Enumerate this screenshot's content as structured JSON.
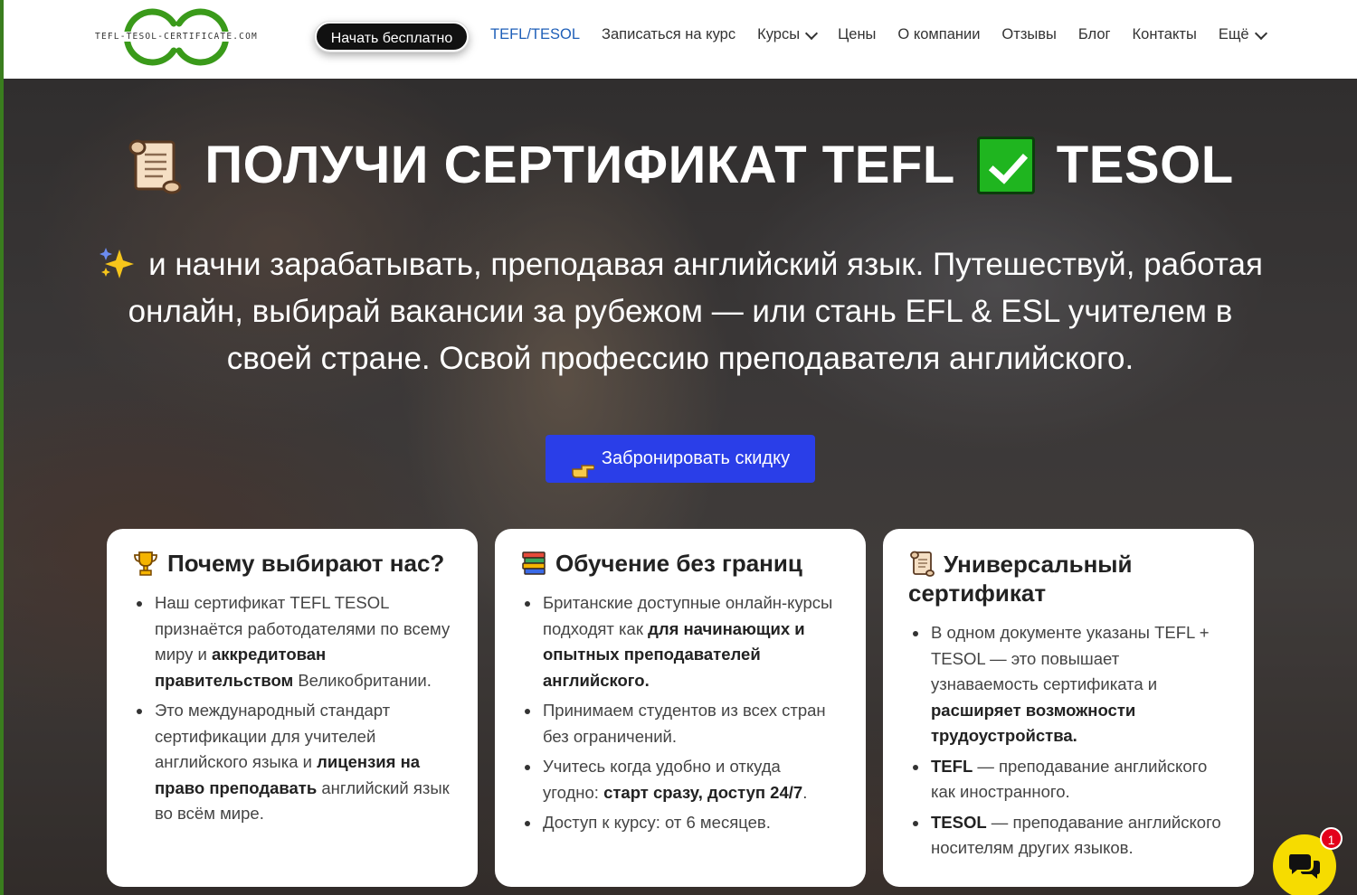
{
  "header": {
    "logo_text": "TEFL-TESOL-CERTIFICATE.COM",
    "cta_label": "Начать бесплатно",
    "nav": [
      {
        "label": "TEFL/TESOL",
        "active": true
      },
      {
        "label": "Записаться на курс"
      },
      {
        "label": "Курсы",
        "has_dropdown": true
      },
      {
        "label": "Цены"
      },
      {
        "label": "О компании"
      },
      {
        "label": "Отзывы"
      },
      {
        "label": "Блог"
      },
      {
        "label": "Контакты"
      },
      {
        "label": "Ещё",
        "has_dropdown": true
      }
    ]
  },
  "hero": {
    "title_part1": "ПОЛУЧИ СЕРТИФИКАТ TEFL",
    "title_part2": "TESOL",
    "title_icon_left": "scroll-icon",
    "title_icon_mid": "check-mark-icon",
    "subtitle_icon": "sparkles-icon",
    "subtitle": "и начни зарабатывать, преподавая английский язык. Путешествуй, работая онлайн, выбирай вакансии за рубежом — или стань EFL & ESL учителем в своей стране. Освой профессию преподавателя английского.",
    "button_label": "Забронировать скидку",
    "button_icon": "pointing-hand-icon"
  },
  "cards": [
    {
      "icon": "trophy-icon",
      "title": "Почему выбирают нас?",
      "items": [
        [
          "Наш сертификат TEFL TESOL признаётся работодателями по всему миру и ",
          "аккредитован правительством",
          " Великобритании."
        ],
        [
          "Это международный стандарт сертификации для учителей английского языка и ",
          "лицензия на право преподавать",
          " английский язык во всём мире."
        ]
      ]
    },
    {
      "icon": "books-icon",
      "title": "Обучение без границ",
      "items": [
        [
          "Британские доступные онлайн-курсы подходят как ",
          "для начинающих и опытных преподавателей английского.",
          ""
        ],
        [
          "Принимаем студентов из всех стран без ограничений.",
          "",
          ""
        ],
        [
          "Учитесь когда удобно и откуда угодно: ",
          "старт сразу, доступ 24/7",
          "."
        ],
        [
          "Доступ к курсу: от 6 месяцев.",
          "",
          ""
        ]
      ]
    },
    {
      "icon": "scroll-icon",
      "title": "Универсальный сертификат",
      "items": [
        [
          "В одном документе указаны TEFL + TESOL — это повышает узнаваемость сертификата и ",
          "расширяет возможности трудоустройства.",
          ""
        ],
        [
          "",
          "TEFL",
          " — преподавание английского как иностранного."
        ],
        [
          "",
          "TESOL",
          " — преподавание английского носителям других языков."
        ]
      ]
    }
  ],
  "chat": {
    "icon": "chat-bubbles-icon",
    "badge_count": "1"
  },
  "colors": {
    "accent_blue": "#2a3ee8",
    "nav_active": "#1f5fb8",
    "logo_green": "#3a9a1a",
    "chat_yellow": "#f6dc00",
    "badge_red": "#e3001b"
  }
}
